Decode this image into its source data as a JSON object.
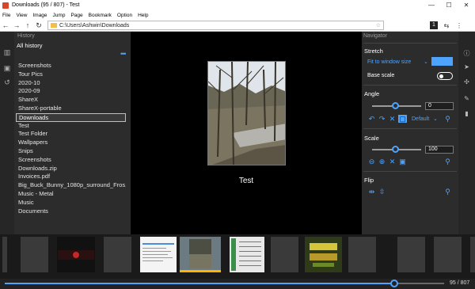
{
  "window": {
    "title": "Downloads (95 / 807) - Test",
    "min": "—",
    "max": "☐",
    "close": "✕"
  },
  "menu": [
    "File",
    "View",
    "Image",
    "Jump",
    "Page",
    "Bookmark",
    "Option",
    "Help"
  ],
  "addressbar": {
    "path": "C:\\Users\\Ashwin\\Downloads",
    "back": "←",
    "forward": "→",
    "up": "↑",
    "refresh": "↻",
    "star": "☆",
    "btn1": "1",
    "btn_back": "⇆",
    "btn_more": "⋮"
  },
  "history": {
    "header": "History",
    "all": "All history",
    "more": "•••",
    "items": [
      "Screenshots",
      "Tour Pics",
      "2020-10",
      "2020-09",
      "ShareX",
      "ShareX-portable",
      "Downloads",
      "Test",
      "Test Folder",
      "Wallpapers",
      "Snips",
      "Screenshots",
      "Downloads.zip",
      "Invoices.pdf",
      "Big_Buck_Bunny_1080p_surround_Fros...",
      "Music - Metal",
      "Music",
      "Documents"
    ],
    "selected": 6
  },
  "viewer": {
    "caption": "Test"
  },
  "navigator": {
    "header": "Navigator",
    "stretch": {
      "title": "Stretch",
      "mode": "Fit to window size",
      "base_scale": "Base scale"
    },
    "angle": {
      "title": "Angle",
      "value": "0",
      "default": "Default"
    },
    "scale": {
      "title": "Scale",
      "value": "100"
    },
    "flip": {
      "title": "Flip"
    }
  },
  "pagination": {
    "current": "95 / 807",
    "fraction": 0.118
  },
  "colors": {
    "accent": "#4ea3ff",
    "highlight": "#ffb400"
  }
}
